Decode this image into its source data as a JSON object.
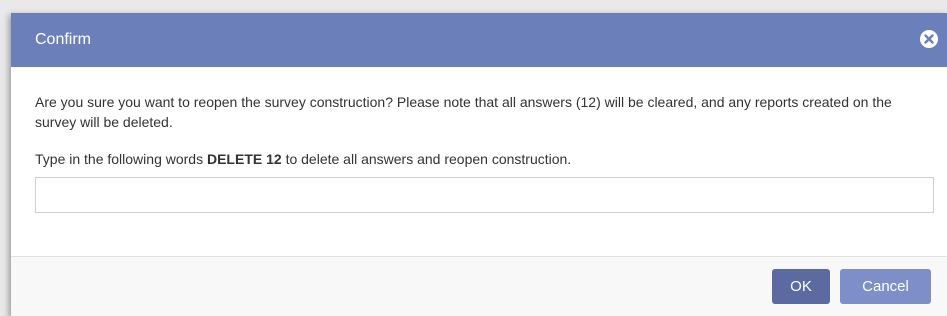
{
  "dialog": {
    "title": "Confirm",
    "message": "Are you sure you want to reopen the survey construction? Please note that all answers (12) will be cleared, and any reports created on the survey will be deleted.",
    "instruction_prefix": "Type in the following words ",
    "instruction_keyword": "DELETE 12",
    "instruction_suffix": " to delete all answers and reopen construction.",
    "input_value": "",
    "input_placeholder": "",
    "ok_label": "OK",
    "cancel_label": "Cancel",
    "close_icon": "close-icon"
  },
  "colors": {
    "titlebar": "#6b7fba",
    "ok_button": "#5b6aa0",
    "cancel_button": "#7d8ec8",
    "text": "#333333"
  }
}
